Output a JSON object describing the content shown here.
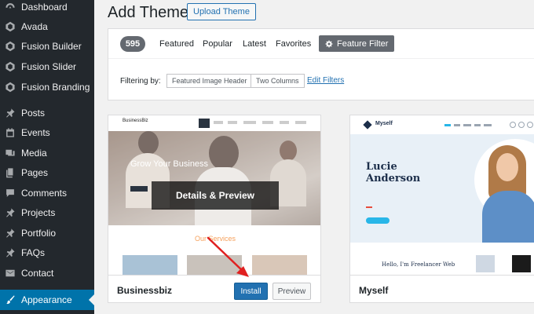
{
  "sidebar": {
    "items": [
      {
        "label": "Dashboard",
        "icon": "dashboard-icon"
      },
      {
        "label": "Avada",
        "icon": "avada-icon"
      },
      {
        "label": "Fusion Builder",
        "icon": "fusion-builder-icon"
      },
      {
        "label": "Fusion Slider",
        "icon": "fusion-slider-icon"
      },
      {
        "label": "Fusion Branding",
        "icon": "fusion-branding-icon"
      },
      {
        "label": "Posts",
        "icon": "pin-icon"
      },
      {
        "label": "Events",
        "icon": "calendar-icon"
      },
      {
        "label": "Media",
        "icon": "media-icon"
      },
      {
        "label": "Pages",
        "icon": "pages-icon"
      },
      {
        "label": "Comments",
        "icon": "comments-icon"
      },
      {
        "label": "Projects",
        "icon": "pin-icon"
      },
      {
        "label": "Portfolio",
        "icon": "pin-icon"
      },
      {
        "label": "FAQs",
        "icon": "pin-icon"
      },
      {
        "label": "Contact",
        "icon": "mail-icon"
      },
      {
        "label": "Appearance",
        "icon": "brush-icon",
        "active": true
      }
    ]
  },
  "header": {
    "title": "Add Themes",
    "upload_label": "Upload Theme"
  },
  "filters": {
    "count": "595",
    "tabs": [
      "Featured",
      "Popular",
      "Latest",
      "Favorites"
    ],
    "feature_filter_label": "Feature Filter",
    "filtering_label": "Filtering by:",
    "tags": [
      "Featured Image Header",
      "Two Columns"
    ],
    "edit_label": "Edit Filters"
  },
  "themes": [
    {
      "name": "Businessbiz",
      "overlay_label": "Details & Preview",
      "install_label": "Install",
      "preview_label": "Preview",
      "shot": {
        "logo": "BusinessBiz",
        "tagline": "Grow Your Business",
        "section": "Our Services"
      }
    },
    {
      "name": "Myself",
      "shot": {
        "logo": "Myself",
        "title_line1": "Lucie",
        "title_line2": "Anderson",
        "lower_text_line1": "Hello, I'm Freelancer Web"
      }
    }
  ],
  "colors": {
    "sidebar_bg": "#23282d",
    "active_menu": "#0073aa",
    "primary_button": "#2271b1",
    "badge_bg": "#646970"
  }
}
